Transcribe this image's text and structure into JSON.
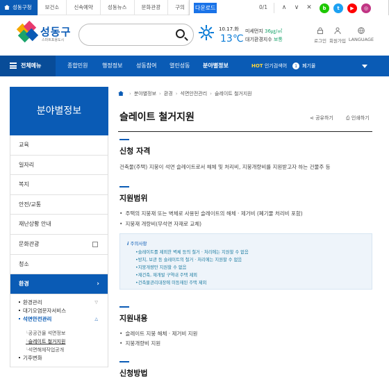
{
  "topbar": {
    "tabs": [
      "성동구청",
      "보건소",
      "신속예약",
      "성동뉴스",
      "문화관광",
      "구의"
    ]
  },
  "findbar": {
    "query": "다운로드",
    "count": "0/1",
    "up": "∧",
    "down": "∨",
    "close": "✕"
  },
  "social": [
    {
      "name": "blog-icon",
      "label": "b",
      "color": "#1ec800"
    },
    {
      "name": "twitter-icon",
      "label": "t",
      "color": "#1da1f2"
    },
    {
      "name": "youtube-icon",
      "label": "▶",
      "color": "#ff0000"
    },
    {
      "name": "instagram-icon",
      "label": "◎",
      "color": "#c13584"
    }
  ],
  "header": {
    "logo": "성동구",
    "logo_sub": "스마트포용도시",
    "weather_date": "10.17.화",
    "weather_temp": "13℃",
    "dust_label": "미세먼지",
    "dust_value": "36㎍/㎥",
    "air_label": "대기환경지수",
    "air_value": "보통",
    "login": "로그인",
    "join": "회원가입",
    "language": "LANGUAGE"
  },
  "gnb": {
    "all_menu": "전체메뉴",
    "items": [
      "종합민원",
      "행정정보",
      "성동참여",
      "열린성동",
      "분야별정보"
    ],
    "hot_label": "HOT",
    "hot_text": "인기검색어",
    "hot_rank": "1",
    "hot_keyword": "폐기물"
  },
  "sidebar": {
    "title": "분야별정보",
    "items": [
      "교육",
      "일자리",
      "복지",
      "안전/교통",
      "재난상황 안내",
      "문화관광",
      "청소"
    ],
    "active": "환경",
    "active_arrow": "›",
    "sub": [
      "환경관리",
      "대기오염문자서비스",
      "석면안전관리"
    ],
    "subsub": [
      "공공건물 석면정보",
      "슬레이트 철거지원",
      "석면해체작업공개"
    ],
    "last_sub": "기후변화"
  },
  "content": {
    "breadcrumb": [
      "분야별정보",
      "환경",
      "석면안전관리",
      "슬레이트 철거지원"
    ],
    "title": "슬레이트 철거지원",
    "share": "공유하기",
    "print": "인쇄하기",
    "sec1_title": "신청 자격",
    "sec1_body": "건축물(주택) 지붕이 석면 슬레이트로서 해체 및 처리비, 지붕개량비를 지원받고자 하는 건물주 등",
    "sec2_title": "지원범위",
    "sec2_items": [
      "주택의 지붕재 또는 벽체로 사용된 슬레이트의 해체 · 제거비 (폐기물 처리비 포함)",
      "지붕재 개량비(무석면 자재로 교체)"
    ],
    "note_title": "주의사항",
    "note_items": [
      "슬레이트를 제외한 벽체 등의 철거 · 처리에는 지원할 수 없음",
      "방치, 보관 등 슬레이트의 철거 · 처리에는 지원할 수 없음",
      "지붕개량만 지원할 수 없음",
      "재건축, 재개발 구역내 주택 제외",
      "건축물관리대장에 미등재된 주택 제외"
    ],
    "sec3_title": "지원내용",
    "sec3_items": [
      "슬레이트 지붕 해체 · 제거비 지원",
      "지붕개량비 지원"
    ],
    "sec4_title": "신청방법"
  }
}
